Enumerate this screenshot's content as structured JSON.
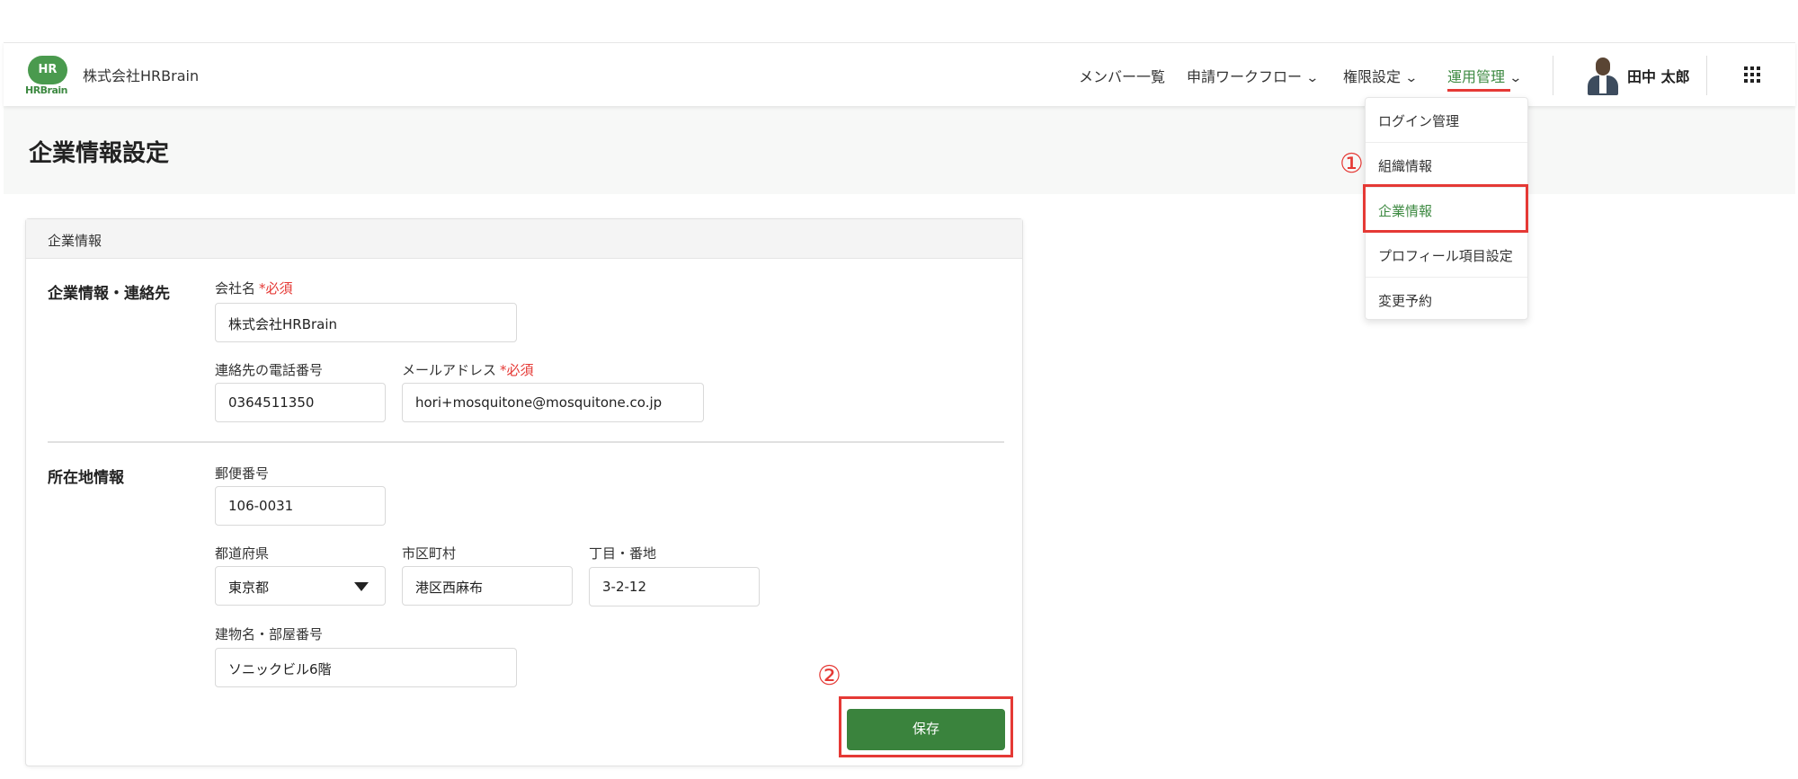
{
  "header": {
    "logo_bubble": "HR",
    "logo_text": "HRBrain",
    "company_name": "株式会社HRBrain",
    "nav": [
      {
        "label": "メンバー一覧",
        "has_menu": false
      },
      {
        "label": "申請ワークフロー",
        "has_menu": true
      },
      {
        "label": "権限設定",
        "has_menu": true
      },
      {
        "label": "運用管理",
        "has_menu": true,
        "active": true
      }
    ],
    "user_name": "田中 太郎",
    "icons": {
      "chevron": "chevron-down-icon",
      "apps": "apps-grid-icon",
      "avatar": "user-avatar"
    }
  },
  "page": {
    "title": "企業情報設定"
  },
  "card": {
    "header": "企業情報",
    "contact_section": {
      "label": "企業情報・連絡先",
      "company_name_label": "会社名",
      "company_name_value": "株式会社HRBrain",
      "phone_label": "連絡先の電話番号",
      "phone_value": "0364511350",
      "email_label": "メールアドレス",
      "email_value": "hori+mosquitone@mosquitone.co.jp",
      "required_mark": "*必須"
    },
    "address_section": {
      "label": "所在地情報",
      "postal_label": "郵便番号",
      "postal_value": "106-0031",
      "prefecture_label": "都道府県",
      "prefecture_value": "東京都",
      "city_label": "市区町村",
      "city_value": "港区西麻布",
      "street_label": "丁目・番地",
      "street_value": "3-2-12",
      "building_label": "建物名・部屋番号",
      "building_value": "ソニックビル6階"
    },
    "save_label": "保存"
  },
  "dropdown": {
    "items": [
      {
        "label": "ログイン管理"
      },
      {
        "label": "組織情報"
      },
      {
        "label": "企業情報",
        "active": true
      },
      {
        "label": "プロフィール項目設定"
      },
      {
        "label": "変更予約"
      }
    ]
  },
  "annotations": {
    "step1": "①",
    "step2": "②",
    "color": "#e53935"
  },
  "colors": {
    "brand_green": "#3a833d",
    "required_red": "#e53935"
  }
}
